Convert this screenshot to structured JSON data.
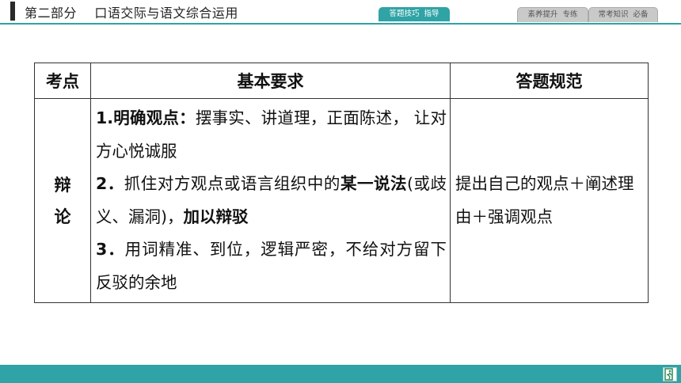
{
  "header": {
    "title": "第二部分    口语交际与语文综合运用",
    "tabs": [
      {
        "label": "答题技巧  指导",
        "active": true
      },
      {
        "label": "素养提升  专练",
        "active": false
      },
      {
        "label": "常考知识  必备",
        "active": false
      }
    ],
    "accent_color": "#2fa3a5"
  },
  "table": {
    "headers": [
      "考点",
      "基本要求",
      "答题规范"
    ],
    "row": {
      "topic_chars": [
        "辩",
        "论"
      ],
      "requirements": [
        {
          "num": "1.",
          "bold": "明确观点：",
          "text": "摆事实、讲道理，正面陈述，  让对方心悦诚服"
        },
        {
          "num": "2．",
          "text_before": "抓住对方观点或语言组织中的",
          "bold": "某一说法",
          "text_middle": "(或歧义、漏洞)，",
          "bold2": "加以辩驳"
        },
        {
          "num": "3．",
          "text": "用词精准、到位，逻辑严密，不给对方留下反驳的余地"
        }
      ],
      "specification": "提出自己的观点＋阐述理由＋强调观点"
    }
  },
  "footer": {
    "exit_icon": "exit-icon"
  }
}
